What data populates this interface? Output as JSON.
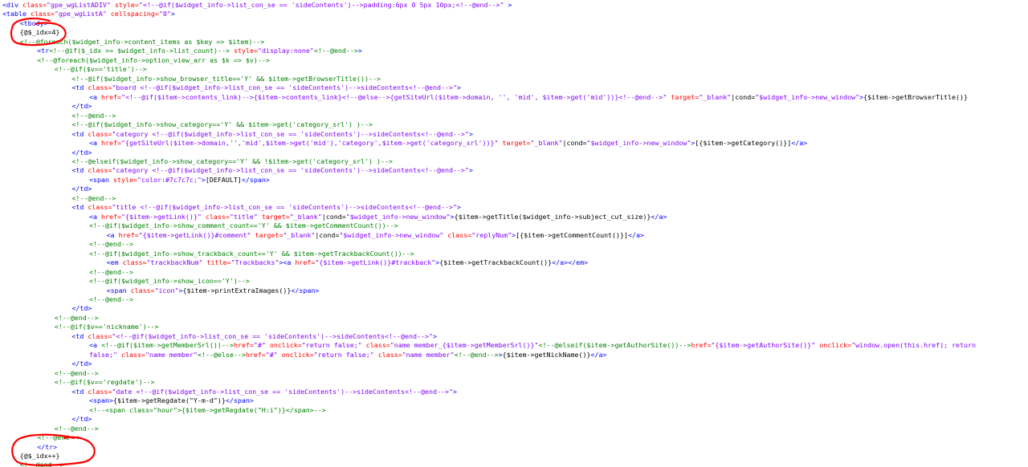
{
  "lines": [
    {
      "indent": 0,
      "segments": [
        {
          "t": "tag",
          "v": "<div "
        },
        {
          "t": "attr",
          "v": "class="
        },
        {
          "t": "val",
          "v": "\"gpe_wgListADIV\""
        },
        {
          "t": "attr",
          "v": " style="
        },
        {
          "t": "val",
          "v": "\"<!--@if($widget_info->list_con_se == 'sideContents')-->padding:6px 0 5px 10px;<!--@end-->\""
        },
        {
          "t": "tag",
          "v": " >"
        }
      ]
    },
    {
      "indent": 0,
      "segments": [
        {
          "t": "tag",
          "v": "<table "
        },
        {
          "t": "attr",
          "v": "class="
        },
        {
          "t": "val",
          "v": "\"gpe_wgListA\""
        },
        {
          "t": "attr",
          "v": " cellspacing="
        },
        {
          "t": "val",
          "v": "\"0\""
        },
        {
          "t": "tag",
          "v": ">"
        }
      ]
    },
    {
      "indent": 2,
      "segments": [
        {
          "t": "tag",
          "v": "<tbody>"
        }
      ]
    },
    {
      "indent": 2,
      "segments": [
        {
          "t": "txt",
          "v": "{@$_idx=4}"
        }
      ]
    },
    {
      "indent": 2,
      "segments": [
        {
          "t": "cmt",
          "v": "<!--@foreach($widget_info->content_items as $key => $item)-->"
        }
      ]
    },
    {
      "indent": 4,
      "segments": [
        {
          "t": "tag",
          "v": "<tr"
        },
        {
          "t": "cmt",
          "v": "<!--@if($_idx >= $widget_info->list_count)-->"
        },
        {
          "t": "attr",
          "v": " style="
        },
        {
          "t": "val",
          "v": "\"display:none\""
        },
        {
          "t": "cmt",
          "v": "<!--@end-->"
        },
        {
          "t": "tag",
          "v": ">"
        }
      ]
    },
    {
      "indent": 4,
      "segments": [
        {
          "t": "cmt",
          "v": "<!--@foreach($widget_info->option_view_arr as $k => $v)-->"
        }
      ]
    },
    {
      "indent": 6,
      "segments": [
        {
          "t": "cmt",
          "v": "<!--@if($v=='title')-->"
        }
      ]
    },
    {
      "indent": 8,
      "segments": [
        {
          "t": "cmt",
          "v": "<!--@if($widget_info->show_browser_title=='Y' && $item->getBrowserTitle())-->"
        }
      ]
    },
    {
      "indent": 8,
      "segments": [
        {
          "t": "tag",
          "v": "<td "
        },
        {
          "t": "attr",
          "v": "class="
        },
        {
          "t": "val",
          "v": "\"board <!--@if($widget_info->list_con_se == 'sideContents')-->sideContents<!--@end-->\""
        },
        {
          "t": "tag",
          "v": ">"
        }
      ]
    },
    {
      "indent": 10,
      "segments": [
        {
          "t": "tag",
          "v": "<a "
        },
        {
          "t": "attr",
          "v": "href="
        },
        {
          "t": "val",
          "v": "\"<!--@if($item->contents_link)-->{$item->contents_link}<!--@else-->{getSiteUrl($item->domain, '', 'mid', $item->get('mid'))}<!--@end-->\""
        },
        {
          "t": "attr",
          "v": " target="
        },
        {
          "t": "val",
          "v": "\"_blank\""
        },
        {
          "t": "txt",
          "v": "|cond="
        },
        {
          "t": "val",
          "v": "\"$widget_info->new_window\""
        },
        {
          "t": "tag",
          "v": ">"
        },
        {
          "t": "txt",
          "v": "{$item->getBrowserTitle()}"
        }
      ]
    },
    {
      "indent": 8,
      "segments": [
        {
          "t": "tag",
          "v": "</td>"
        }
      ]
    },
    {
      "indent": 8,
      "segments": [
        {
          "t": "cmt",
          "v": "<!--@end-->"
        }
      ]
    },
    {
      "indent": 8,
      "segments": [
        {
          "t": "cmt",
          "v": "<!--@if($widget_info->show_category=='Y' && $item->get('category_srl') )-->"
        }
      ]
    },
    {
      "indent": 8,
      "segments": [
        {
          "t": "tag",
          "v": "<td "
        },
        {
          "t": "attr",
          "v": "class="
        },
        {
          "t": "val",
          "v": "\"category <!--@if($widget_info->list_con_se == 'sideContents')-->sideContents<!--@end-->\""
        },
        {
          "t": "tag",
          "v": ">"
        }
      ]
    },
    {
      "indent": 10,
      "segments": [
        {
          "t": "tag",
          "v": "<a "
        },
        {
          "t": "attr",
          "v": "href="
        },
        {
          "t": "val",
          "v": "\"{getSiteUrl($item->domain,'','mid',$item->get('mid'),'category',$item->get('category_srl'))}\""
        },
        {
          "t": "attr",
          "v": " target="
        },
        {
          "t": "val",
          "v": "\"_blank\""
        },
        {
          "t": "txt",
          "v": "|cond="
        },
        {
          "t": "val",
          "v": "\"$widget_info->new_window\""
        },
        {
          "t": "tag",
          "v": ">"
        },
        {
          "t": "txt",
          "v": "[{$item->getCategory()}]"
        },
        {
          "t": "tag",
          "v": "</a>"
        }
      ]
    },
    {
      "indent": 8,
      "segments": [
        {
          "t": "tag",
          "v": "</td>"
        }
      ]
    },
    {
      "indent": 8,
      "segments": [
        {
          "t": "cmt",
          "v": "<!--@elseif($widget_info->show_category=='Y' && !$item->get('category_srl') )-->"
        }
      ]
    },
    {
      "indent": 8,
      "segments": [
        {
          "t": "tag",
          "v": "<td "
        },
        {
          "t": "attr",
          "v": "class="
        },
        {
          "t": "val",
          "v": "\"category <!--@if($widget_info->list_con_se == 'sideContents')-->sideContents<!--@end-->\""
        },
        {
          "t": "tag",
          "v": ">"
        }
      ]
    },
    {
      "indent": 10,
      "segments": [
        {
          "t": "tag",
          "v": "<span "
        },
        {
          "t": "attr",
          "v": "style="
        },
        {
          "t": "val",
          "v": "\"color:#7c7c7c;\""
        },
        {
          "t": "tag",
          "v": ">"
        },
        {
          "t": "txt",
          "v": "[DEFAULT]"
        },
        {
          "t": "tag",
          "v": "</span>"
        }
      ]
    },
    {
      "indent": 8,
      "segments": [
        {
          "t": "tag",
          "v": "</td>"
        }
      ]
    },
    {
      "indent": 8,
      "segments": [
        {
          "t": "cmt",
          "v": "<!--@end-->"
        }
      ]
    },
    {
      "indent": 8,
      "segments": [
        {
          "t": "tag",
          "v": "<td "
        },
        {
          "t": "attr",
          "v": "class="
        },
        {
          "t": "val",
          "v": "\"title <!--@if($widget_info->list_con_se == 'sideContents')-->sideContents<!--@end-->\""
        },
        {
          "t": "tag",
          "v": ">"
        }
      ]
    },
    {
      "indent": 10,
      "segments": [
        {
          "t": "tag",
          "v": "<a "
        },
        {
          "t": "attr",
          "v": "href="
        },
        {
          "t": "val",
          "v": "\"{$item->getLink()}\""
        },
        {
          "t": "attr",
          "v": " class="
        },
        {
          "t": "val",
          "v": "\"title\""
        },
        {
          "t": "attr",
          "v": " target="
        },
        {
          "t": "val",
          "v": "\"_blank\""
        },
        {
          "t": "txt",
          "v": "|cond="
        },
        {
          "t": "val",
          "v": "\"$widget_info->new_window\""
        },
        {
          "t": "tag",
          "v": ">"
        },
        {
          "t": "txt",
          "v": "{$item->getTitle($widget_info->subject_cut_size)}"
        },
        {
          "t": "tag",
          "v": "</a>"
        }
      ]
    },
    {
      "indent": 10,
      "segments": [
        {
          "t": "cmt",
          "v": "<!--@if($widget_info->show_comment_count=='Y' && $item->getCommentCount())-->"
        }
      ]
    },
    {
      "indent": 12,
      "segments": [
        {
          "t": "tag",
          "v": "<a "
        },
        {
          "t": "attr",
          "v": "href="
        },
        {
          "t": "val",
          "v": "\"{$item->getLink()}#comment\""
        },
        {
          "t": "attr",
          "v": " target="
        },
        {
          "t": "val",
          "v": "\"_blank\""
        },
        {
          "t": "txt",
          "v": "|cond="
        },
        {
          "t": "val",
          "v": "\"$widget_info->new_window\""
        },
        {
          "t": "attr",
          "v": " class="
        },
        {
          "t": "val",
          "v": "\"replyNum\""
        },
        {
          "t": "tag",
          "v": ">"
        },
        {
          "t": "txt",
          "v": "[{$item->getCommentCount()}]"
        },
        {
          "t": "tag",
          "v": "</a>"
        }
      ]
    },
    {
      "indent": 10,
      "segments": [
        {
          "t": "cmt",
          "v": "<!--@end-->"
        }
      ]
    },
    {
      "indent": 10,
      "segments": [
        {
          "t": "cmt",
          "v": "<!--@if($widget_info->show_trackback_count=='Y' && $item->getTrackbackCount())-->"
        }
      ]
    },
    {
      "indent": 12,
      "segments": [
        {
          "t": "tag",
          "v": "<em "
        },
        {
          "t": "attr",
          "v": "class="
        },
        {
          "t": "val",
          "v": "\"trackbackNum\""
        },
        {
          "t": "attr",
          "v": " title="
        },
        {
          "t": "val",
          "v": "\"Trackbacks\""
        },
        {
          "t": "tag",
          "v": "><a "
        },
        {
          "t": "attr",
          "v": "href="
        },
        {
          "t": "val",
          "v": "\"{$item->getLink()}#trackback\""
        },
        {
          "t": "tag",
          "v": ">"
        },
        {
          "t": "txt",
          "v": "{$item->getTrackbackCount()}"
        },
        {
          "t": "tag",
          "v": "</a></em>"
        }
      ]
    },
    {
      "indent": 10,
      "segments": [
        {
          "t": "cmt",
          "v": "<!--@end-->"
        }
      ]
    },
    {
      "indent": 10,
      "segments": [
        {
          "t": "cmt",
          "v": "<!--@if($widget_info->show_icon=='Y')-->"
        }
      ]
    },
    {
      "indent": 12,
      "segments": [
        {
          "t": "tag",
          "v": "<span "
        },
        {
          "t": "attr",
          "v": "class="
        },
        {
          "t": "val",
          "v": "\"icon\""
        },
        {
          "t": "tag",
          "v": ">"
        },
        {
          "t": "txt",
          "v": "{$item->printExtraImages()}"
        },
        {
          "t": "tag",
          "v": "</span>"
        }
      ]
    },
    {
      "indent": 10,
      "segments": [
        {
          "t": "cmt",
          "v": "<!--@end-->"
        }
      ]
    },
    {
      "indent": 8,
      "segments": [
        {
          "t": "tag",
          "v": "</td>"
        }
      ]
    },
    {
      "indent": 6,
      "segments": [
        {
          "t": "cmt",
          "v": "<!--@end-->"
        }
      ]
    },
    {
      "indent": 6,
      "segments": [
        {
          "t": "cmt",
          "v": "<!--@if($v=='nickname')-->"
        }
      ]
    },
    {
      "indent": 8,
      "segments": [
        {
          "t": "tag",
          "v": "<td "
        },
        {
          "t": "attr",
          "v": "class="
        },
        {
          "t": "val",
          "v": "\"<!--@if($widget_info->list_con_se == 'sideContents')-->sideContents<!--@end-->\""
        },
        {
          "t": "tag",
          "v": ">"
        }
      ]
    },
    {
      "indent": 10,
      "segments": [
        {
          "t": "tag",
          "v": "<a "
        },
        {
          "t": "cmt",
          "v": "<!--@if($item->getMemberSrl())-->"
        },
        {
          "t": "attr",
          "v": "href="
        },
        {
          "t": "val",
          "v": "\"#\""
        },
        {
          "t": "attr",
          "v": " onclick="
        },
        {
          "t": "val",
          "v": "\"return false;\""
        },
        {
          "t": "attr",
          "v": " class="
        },
        {
          "t": "val",
          "v": "\"name member_{$item->getMemberSrl()}\""
        },
        {
          "t": "cmt",
          "v": "<!--@elseif($item->getAuthorSite())-->"
        },
        {
          "t": "attr",
          "v": "href="
        },
        {
          "t": "val",
          "v": "\"{$item->getAuthorSite()}\""
        },
        {
          "t": "attr",
          "v": " onclick="
        },
        {
          "t": "val",
          "v": "\"window.open(this.href); return"
        }
      ]
    },
    {
      "indent": 10,
      "segments": [
        {
          "t": "val",
          "v": "false;\""
        },
        {
          "t": "attr",
          "v": " class="
        },
        {
          "t": "val",
          "v": "\"name member\""
        },
        {
          "t": "cmt",
          "v": "<!--@else-->"
        },
        {
          "t": "attr",
          "v": "href="
        },
        {
          "t": "val",
          "v": "\"#\""
        },
        {
          "t": "attr",
          "v": " onclick="
        },
        {
          "t": "val",
          "v": "\"return false;\""
        },
        {
          "t": "attr",
          "v": " class="
        },
        {
          "t": "val",
          "v": "\"name member\""
        },
        {
          "t": "cmt",
          "v": "<!--@end-->"
        },
        {
          "t": "tag",
          "v": ">"
        },
        {
          "t": "txt",
          "v": "{$item->getNickName()}"
        },
        {
          "t": "tag",
          "v": "</a>"
        }
      ]
    },
    {
      "indent": 8,
      "segments": [
        {
          "t": "tag",
          "v": "</td>"
        }
      ]
    },
    {
      "indent": 6,
      "segments": [
        {
          "t": "cmt",
          "v": "<!--@end-->"
        }
      ]
    },
    {
      "indent": 6,
      "segments": [
        {
          "t": "cmt",
          "v": "<!--@if($v=='regdate')-->"
        }
      ]
    },
    {
      "indent": 8,
      "segments": [
        {
          "t": "tag",
          "v": "<td "
        },
        {
          "t": "attr",
          "v": "class="
        },
        {
          "t": "val",
          "v": "\"date <!--@if($widget_info->list_con_se == 'sideContents')-->sideContents<!--@end-->\""
        },
        {
          "t": "tag",
          "v": ">"
        }
      ]
    },
    {
      "indent": 10,
      "segments": [
        {
          "t": "tag",
          "v": "<span>"
        },
        {
          "t": "txt",
          "v": "{$item->getRegdate(\"Y-m-d\")}"
        },
        {
          "t": "tag",
          "v": "</span>"
        }
      ]
    },
    {
      "indent": 10,
      "segments": [
        {
          "t": "cmt",
          "v": "<!--<span class=\"hour\">{$item->getRegdate(\"H:i\")}</span>-->"
        }
      ]
    },
    {
      "indent": 8,
      "segments": [
        {
          "t": "tag",
          "v": "</td>"
        }
      ]
    },
    {
      "indent": 6,
      "segments": [
        {
          "t": "cmt",
          "v": "<!--@end-->"
        }
      ]
    },
    {
      "indent": 4,
      "segments": [
        {
          "t": "cmt",
          "v": "<!--@end-->"
        }
      ]
    },
    {
      "indent": 4,
      "segments": [
        {
          "t": "tag",
          "v": "</tr>"
        }
      ]
    },
    {
      "indent": 2,
      "segments": [
        {
          "t": "txt",
          "v": "{@$_idx++}"
        }
      ]
    },
    {
      "indent": 2,
      "segments": [
        {
          "t": "cmt",
          "v": "<!--@end-->"
        }
      ]
    }
  ],
  "colors": {
    "tag": "#0000ff",
    "attr": "#ff0000",
    "value": "#8000ff",
    "comment": "#008000",
    "text": "#000000",
    "annotation": "#ff0000"
  }
}
